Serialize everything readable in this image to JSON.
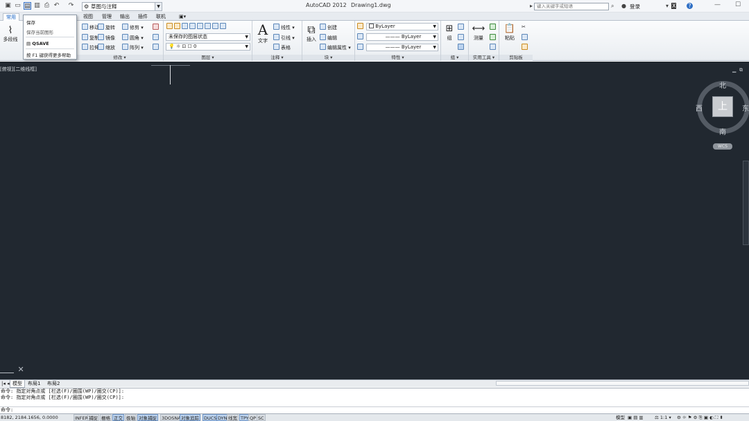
{
  "titlebar": {
    "workspace": "草图与注释",
    "app_title": "AutoCAD 2012",
    "doc_title": "Drawing1.dwg",
    "search_placeholder": "键入关键字或短语",
    "login": "登录"
  },
  "tabs": [
    {
      "label": "常用",
      "active": true
    },
    {
      "label": "视图"
    },
    {
      "label": "管理"
    },
    {
      "label": "输出"
    },
    {
      "label": "插件"
    },
    {
      "label": "联机"
    }
  ],
  "save_menu": {
    "item1": "保存",
    "item2": "保存当前图形",
    "item3": "QSAVE",
    "item4": "按 F1 键获得更多帮助"
  },
  "ribbon": {
    "draw": {
      "polyline": "多段线"
    },
    "modify": {
      "title": "修改",
      "move": "移动",
      "rotate": "旋转",
      "trim": "修剪",
      "copy": "复制",
      "mirror": "镜像",
      "fillet": "圆角",
      "stretch": "拉伸",
      "scale": "缩放",
      "array": "阵列"
    },
    "layers": {
      "title": "图层",
      "state": "未保存的图层状态",
      "current": "0"
    },
    "annotation": {
      "title": "注释",
      "text": "文字",
      "linear": "线性",
      "leader": "引线",
      "table": "表格"
    },
    "block": {
      "title": "块",
      "insert": "插入",
      "create": "创建",
      "edit": "编辑",
      "attr": "编辑属性"
    },
    "properties": {
      "title": "特性",
      "color": "ByLayer",
      "lineweight": "ByLayer",
      "linetype": "ByLayer"
    },
    "groups": {
      "title": "组",
      "group": "组"
    },
    "utilities": {
      "title": "实用工具",
      "measure": "测量"
    },
    "clipboard": {
      "title": "剪贴板",
      "paste": "粘贴"
    }
  },
  "viewport": {
    "label": "[俯视][二维线框]",
    "compass": {
      "n": "北",
      "s": "南",
      "w": "西",
      "e": "东",
      "top": "上"
    },
    "wcs": "WCS"
  },
  "layout_tabs": [
    {
      "label": "模型",
      "active": true
    },
    {
      "label": "布局1"
    },
    {
      "label": "布局2"
    }
  ],
  "command": {
    "history": [
      "指定对角点或 [栏选(F)/圈围(WP)/圈交(CP)]:",
      "指定对角点或 [栏选(F)/圈围(WP)/圈交(CP)]:"
    ],
    "prompt": ""
  },
  "status": {
    "coords": "8182, 2184.1656, 0.0000",
    "toggles": [
      {
        "label": "INFER",
        "on": false
      },
      {
        "label": "捕捉",
        "on": false
      },
      {
        "label": "栅格",
        "on": false
      },
      {
        "label": "正交",
        "on": true
      },
      {
        "label": "极轴",
        "on": false
      },
      {
        "label": "对象捕捉",
        "on": true
      },
      {
        "label": "3DOSNAP",
        "on": false
      },
      {
        "label": "对象追踪",
        "on": true
      },
      {
        "label": "DUCS",
        "on": true
      },
      {
        "label": "DYN",
        "on": true
      },
      {
        "label": "线宽",
        "on": false
      },
      {
        "label": "TPY",
        "on": true
      },
      {
        "label": "QP",
        "on": false
      },
      {
        "label": "SC",
        "on": false
      }
    ],
    "model": "模型",
    "scale": "1:1"
  }
}
